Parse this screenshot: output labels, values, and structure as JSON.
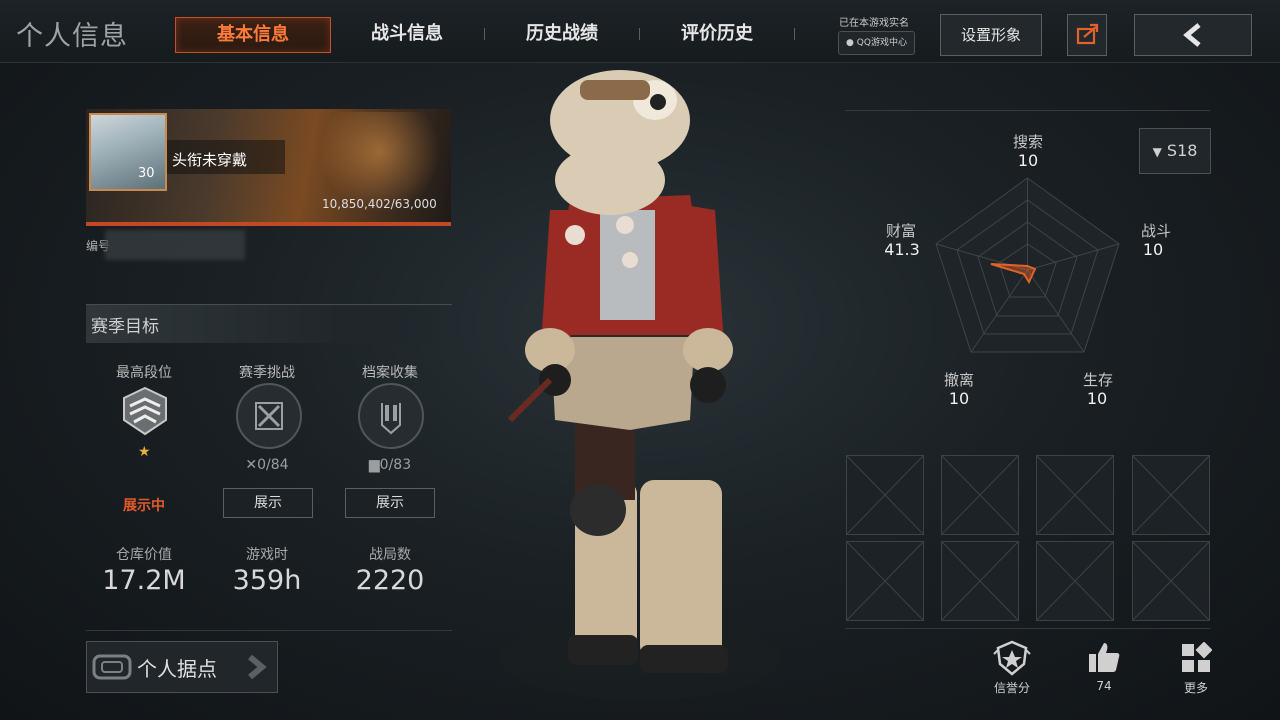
{
  "header": {
    "page_title": "个人信息",
    "tabs": [
      {
        "label": "基本信息",
        "active": true
      },
      {
        "label": "战斗信息",
        "active": false
      },
      {
        "label": "历史战绩",
        "active": false
      },
      {
        "label": "评价历史",
        "active": false
      }
    ],
    "realname_text": "已在本游戏实名",
    "qq_badge": "QQ游戏中心",
    "set_avatar_label": "设置形象"
  },
  "profile": {
    "level": "30",
    "title": "头衔未穿戴",
    "exp": "10,850,402/63,000",
    "id_label": "编号"
  },
  "season": {
    "title": "赛季目标",
    "goals": [
      {
        "label": "最高段位",
        "count": "",
        "action": "展示中"
      },
      {
        "label": "赛季挑战",
        "count": "0/84",
        "action": "展示"
      },
      {
        "label": "档案收集",
        "count": "0/83",
        "action": "展示"
      }
    ],
    "stats": [
      {
        "label": "仓库价值",
        "value": "17.2M"
      },
      {
        "label": "游戏时",
        "value": "359h"
      },
      {
        "label": "战局数",
        "value": "2220"
      }
    ],
    "base_label": "个人据点"
  },
  "radar": {
    "season_label": "S18",
    "axes": [
      {
        "label": "搜索",
        "value": "10"
      },
      {
        "label": "战斗",
        "value": "10"
      },
      {
        "label": "生存",
        "value": "10"
      },
      {
        "label": "撤离",
        "value": "10"
      },
      {
        "label": "财富",
        "value": "41.3"
      }
    ],
    "accent_color": "#e2622a"
  },
  "bottom": {
    "credit_label": "信誉分",
    "likes": "74",
    "more_label": "更多"
  },
  "icons": {
    "share": "share-icon",
    "back": "chevron-left-icon",
    "dropdown": "triangle-down-icon",
    "credit": "shield-star-icon",
    "like": "thumbs-up-icon",
    "more": "grid-icon"
  }
}
